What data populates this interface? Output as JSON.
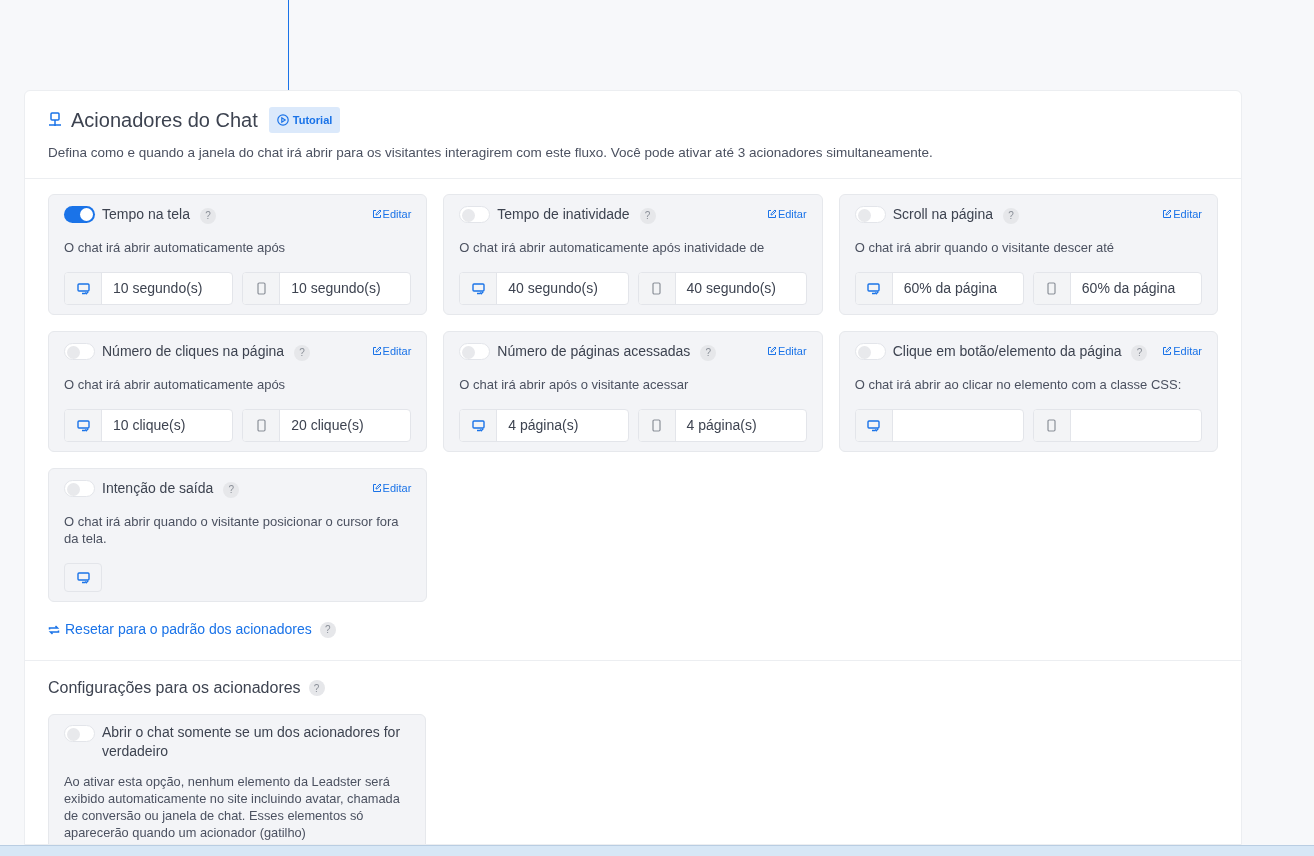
{
  "section": {
    "title": "Acionadores do Chat",
    "tutorial_button": "Tutorial",
    "description": "Defina como e quando a janela do chat irá abrir para os visitantes interagirem com este fluxo. Você pode ativar até 3 acionadores simultaneamente."
  },
  "triggers": [
    {
      "kind": "pair",
      "name": "Tempo na tela",
      "help": "?",
      "edit": "Editar",
      "on": true,
      "text": "O chat irá abrir automaticamente após",
      "desktop_value": "10 segundo(s)",
      "mobile_value": "10 segundo(s)"
    },
    {
      "kind": "pair",
      "name": "Tempo de inatividade",
      "help": "?",
      "edit": "Editar",
      "on": false,
      "text": "O chat irá abrir automaticamente após inatividade de",
      "desktop_value": "40 segundo(s)",
      "mobile_value": "40 segundo(s)"
    },
    {
      "kind": "pair",
      "name": "Scroll na página",
      "help": "?",
      "edit": "Editar",
      "on": false,
      "text": "O chat irá abrir quando o visitante descer até",
      "desktop_value": "60% da página",
      "mobile_value": "60% da página"
    },
    {
      "kind": "pair",
      "name": "Número de cliques na página",
      "help": "?",
      "edit": "Editar",
      "on": false,
      "text": "O chat irá abrir automaticamente após",
      "desktop_value": "10 clique(s)",
      "mobile_value": "20 clique(s)"
    },
    {
      "kind": "pair",
      "name": "Número de páginas acessadas",
      "help": "?",
      "edit": "Editar",
      "on": false,
      "text": "O chat irá abrir após o visitante acessar",
      "desktop_value": "4 página(s)",
      "mobile_value": "4 página(s)"
    },
    {
      "kind": "pair",
      "name": "Clique em botão/elemento da página",
      "help": "?",
      "edit": "Editar",
      "on": false,
      "text": "O chat irá abrir ao clicar no elemento com a classe CSS:"
    },
    {
      "kind": "desktop_only",
      "name": "Intenção de saída",
      "help": "?",
      "edit": "Editar",
      "on": false,
      "text": "O chat irá abrir quando o visitante posicionar o cursor fora da tela."
    }
  ],
  "reset_link": {
    "label": "Resetar para o padrão dos acionadores",
    "help": "?"
  },
  "settings": {
    "title": "Configurações para os acionadores",
    "help": "?",
    "options": [
      {
        "label": "Abrir o chat somente se um dos acionadores for verdadeiro",
        "on": false,
        "text": "Ao ativar esta opção, nenhum elemento da Leadster será exibido automaticamente no site incluindo avatar, chamada de conversão ou janela de chat. Esses elementos só aparecerão quando um acionador (gatilho)"
      }
    ]
  }
}
